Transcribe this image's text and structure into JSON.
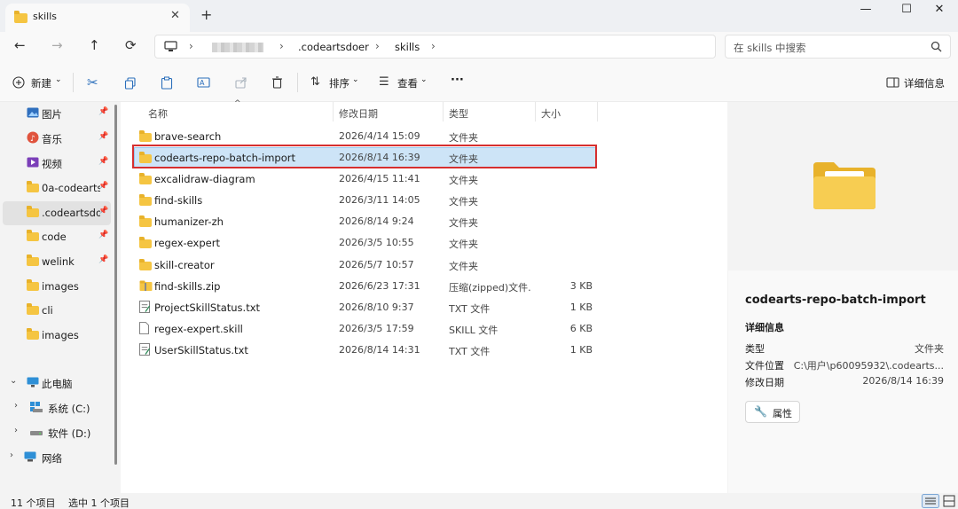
{
  "window": {
    "tab_title": "skills",
    "new_tab": "+",
    "close_tab": "✕"
  },
  "nav": {
    "back": "←",
    "forward": "→",
    "up": "↑",
    "refresh": "⟳",
    "breadcrumb": [
      ".codeartsdoer",
      "skills"
    ],
    "search_placeholder": "在 skills 中搜索"
  },
  "toolbar": {
    "new_label": "新建",
    "sort_label": "排序",
    "view_label": "查看",
    "more_label": "···",
    "details_label": "详细信息"
  },
  "sidebar": {
    "items": [
      {
        "label": "图片",
        "icon": "pictures-icon",
        "pinned": true
      },
      {
        "label": "音乐",
        "icon": "music-icon",
        "pinned": true
      },
      {
        "label": "视频",
        "icon": "video-icon",
        "pinned": true
      },
      {
        "label": "0a-codearts",
        "icon": "folder-icon",
        "pinned": true
      },
      {
        "label": ".codeartsdo",
        "icon": "folder-icon",
        "pinned": true,
        "selected": true
      },
      {
        "label": "code",
        "icon": "folder-icon",
        "pinned": true
      },
      {
        "label": "welink",
        "icon": "folder-icon",
        "pinned": true
      },
      {
        "label": "images",
        "icon": "folder-icon",
        "pinned": false
      },
      {
        "label": "cli",
        "icon": "folder-icon",
        "pinned": false
      },
      {
        "label": "images",
        "icon": "folder-icon",
        "pinned": false
      }
    ],
    "this_pc": "此电脑",
    "drive_c": "系统 (C:)",
    "drive_d": "软件 (D:)",
    "network": "网络"
  },
  "columns": {
    "name": "名称",
    "modified": "修改日期",
    "type": "类型",
    "size": "大小"
  },
  "files": [
    {
      "name": "brave-search",
      "modified": "2026/4/14 15:09",
      "type": "文件夹",
      "size": "",
      "kind": "folder"
    },
    {
      "name": "codearts-repo-batch-import",
      "modified": "2026/8/14 16:39",
      "type": "文件夹",
      "size": "",
      "kind": "folder",
      "selected": true
    },
    {
      "name": "excalidraw-diagram",
      "modified": "2026/4/15 11:41",
      "type": "文件夹",
      "size": "",
      "kind": "folder"
    },
    {
      "name": "find-skills",
      "modified": "2026/3/11 14:05",
      "type": "文件夹",
      "size": "",
      "kind": "folder"
    },
    {
      "name": "humanizer-zh",
      "modified": "2026/8/14 9:24",
      "type": "文件夹",
      "size": "",
      "kind": "folder"
    },
    {
      "name": "regex-expert",
      "modified": "2026/3/5 10:55",
      "type": "文件夹",
      "size": "",
      "kind": "folder"
    },
    {
      "name": "skill-creator",
      "modified": "2026/5/7 10:57",
      "type": "文件夹",
      "size": "",
      "kind": "folder"
    },
    {
      "name": "find-skills.zip",
      "modified": "2026/6/23 17:31",
      "type": "压缩(zipped)文件...",
      "size": "3 KB",
      "kind": "zip"
    },
    {
      "name": "ProjectSkillStatus.txt",
      "modified": "2026/8/10 9:37",
      "type": "TXT 文件",
      "size": "1 KB",
      "kind": "txt"
    },
    {
      "name": "regex-expert.skill",
      "modified": "2026/3/5 17:59",
      "type": "SKILL 文件",
      "size": "6 KB",
      "kind": "file"
    },
    {
      "name": "UserSkillStatus.txt",
      "modified": "2026/8/14 14:31",
      "type": "TXT 文件",
      "size": "1 KB",
      "kind": "txt"
    }
  ],
  "details": {
    "name": "codearts-repo-batch-import",
    "section": "详细信息",
    "type_label": "类型",
    "type_value": "文件夹",
    "location_label": "文件位置",
    "location_value": "C:\\用户\\p60095932\\.codearts...",
    "modified_label": "修改日期",
    "modified_value": "2026/8/14 16:39",
    "properties_label": "属性"
  },
  "status": {
    "count": "11 个项目",
    "selected": "选中 1 个项目"
  },
  "colors": {
    "selection": "#cde4f7",
    "highlight_box": "#d62f2f",
    "folder": "#f5c542"
  }
}
